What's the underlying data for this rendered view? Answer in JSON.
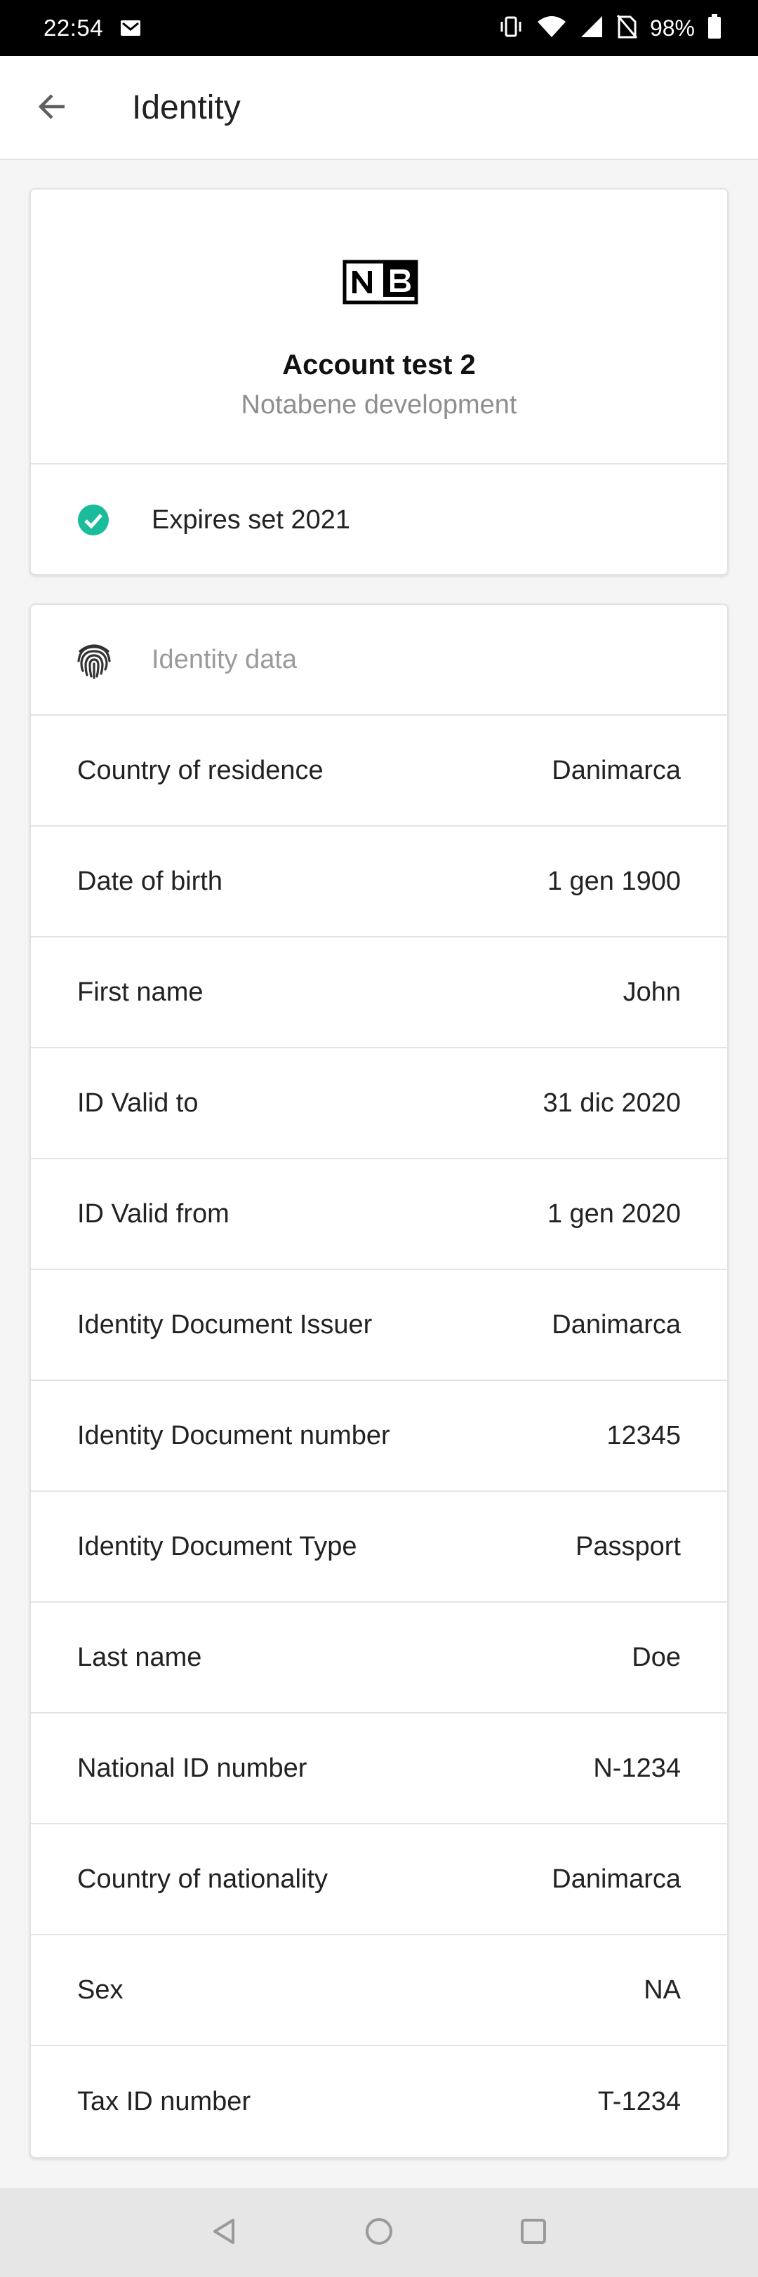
{
  "status_bar": {
    "time": "22:54",
    "battery": "98%"
  },
  "app_bar": {
    "title": "Identity"
  },
  "account": {
    "name": "Account test 2",
    "organization": "Notabene development",
    "expiry": "Expires set 2021",
    "accent_color": "#1bbc9b"
  },
  "identity": {
    "header": "Identity data",
    "rows": [
      {
        "label": "Country of residence",
        "value": "Danimarca"
      },
      {
        "label": "Date of birth",
        "value": "1 gen 1900"
      },
      {
        "label": "First name",
        "value": "John"
      },
      {
        "label": "ID Valid to",
        "value": "31 dic 2020"
      },
      {
        "label": "ID Valid from",
        "value": "1 gen 2020"
      },
      {
        "label": "Identity Document Issuer",
        "value": "Danimarca"
      },
      {
        "label": "Identity Document number",
        "value": "12345"
      },
      {
        "label": "Identity Document Type",
        "value": "Passport"
      },
      {
        "label": "Last name",
        "value": "Doe"
      },
      {
        "label": "National ID number",
        "value": "N-1234"
      },
      {
        "label": "Country of nationality",
        "value": "Danimarca"
      },
      {
        "label": "Sex",
        "value": "NA"
      },
      {
        "label": "Tax ID number",
        "value": "T-1234"
      }
    ]
  },
  "icons": {
    "status_left": "gmail-icon",
    "status_right": [
      "vibrate-icon",
      "wifi-icon",
      "signal-icon",
      "no-sim-icon",
      "battery-icon"
    ],
    "back": "arrow-back-icon",
    "logo": "nb-logo",
    "check": "check-circle-icon",
    "fingerprint": "fingerprint-icon",
    "nav": [
      "nav-back-icon",
      "nav-home-icon",
      "nav-recents-icon"
    ]
  }
}
